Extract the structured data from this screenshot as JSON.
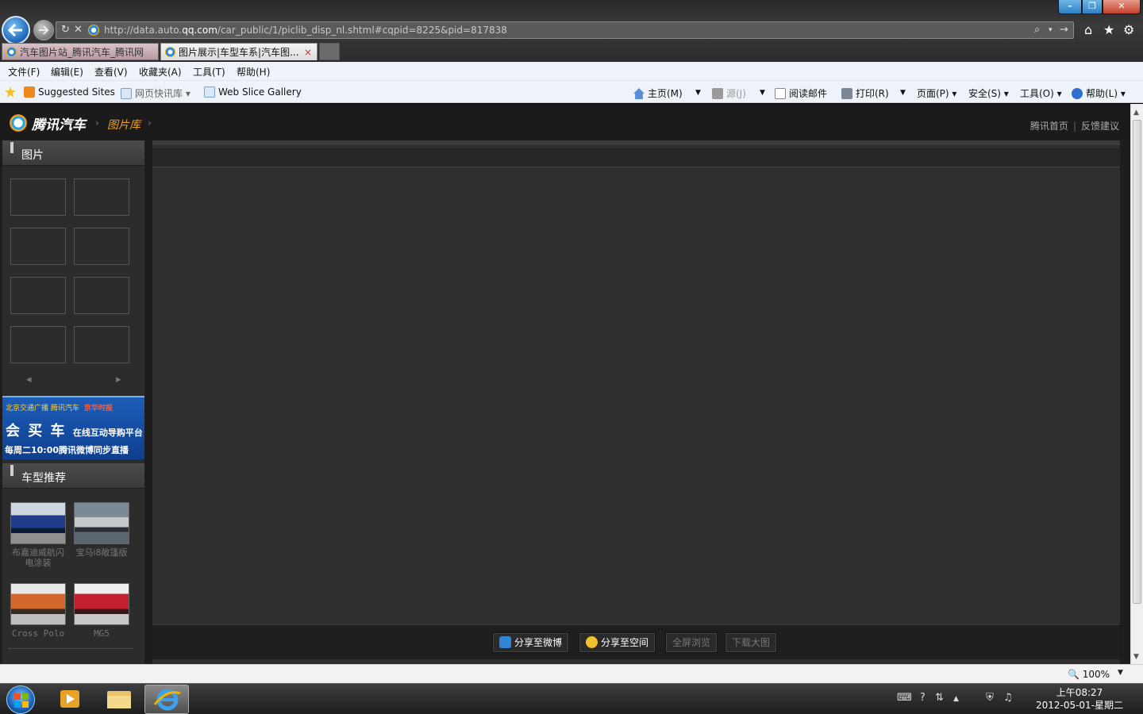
{
  "browser": {
    "url_prefix": "http://data.auto.",
    "url_domain": "qq.com",
    "url_path": "/car_public/1/piclib_disp_nl.shtml#cqpid=8225&pid=817838",
    "tabs": [
      {
        "label": "汽车图片站_腾讯汽车_腾讯网"
      },
      {
        "label": "图片展示|车型车系|汽车图..."
      }
    ],
    "tab_close": "×",
    "menu": [
      "文件(F)",
      "编辑(E)",
      "查看(V)",
      "收藏夹(A)",
      "工具(T)",
      "帮助(H)"
    ],
    "favorites": {
      "suggested": "Suggested Sites",
      "quickfeed": "网页快讯库",
      "webslice": "Web Slice Gallery"
    },
    "commandbar": {
      "home": "主页(M)",
      "feeds": "源(J)",
      "mail": "阅读邮件",
      "print": "打印(R)",
      "page": "页面(P)",
      "safety": "安全(S)",
      "tools": "工具(O)",
      "help": "帮助(L)"
    },
    "zoom": "100%"
  },
  "site": {
    "logo": "腾讯汽车",
    "breadcrumb_gallery": "图片库",
    "header_links": [
      "腾讯首页",
      "反馈建议"
    ],
    "sidebar": {
      "pictures_title": "图片",
      "banner": {
        "line1": "北京交通广播 腾讯汽车",
        "line1_badge": "京华时报",
        "line2": "会 买 车",
        "line2_small": "在线互动导购平台",
        "line3": "每周二10:00腾讯微博同步直播"
      },
      "recommend_title": "车型推荐",
      "recommend": [
        {
          "label": "布嘉迪威航闪电涂装"
        },
        {
          "label": "宝马i8敞篷版"
        },
        {
          "label": "Cross Polo"
        },
        {
          "label": "MG5"
        }
      ]
    },
    "actions": {
      "weibo": "分享至微博",
      "qzone": "分享至空间",
      "fullscreen": "全屏浏览",
      "download": "下载大图"
    }
  },
  "taskbar": {
    "clock_time": "上午08:27",
    "clock_date": "2012-05-01-星期二"
  },
  "colors": {
    "gallery_accent": "#f3a31b",
    "page_bg": "#1d1d1d",
    "browser_chrome": "#eef3fa"
  }
}
